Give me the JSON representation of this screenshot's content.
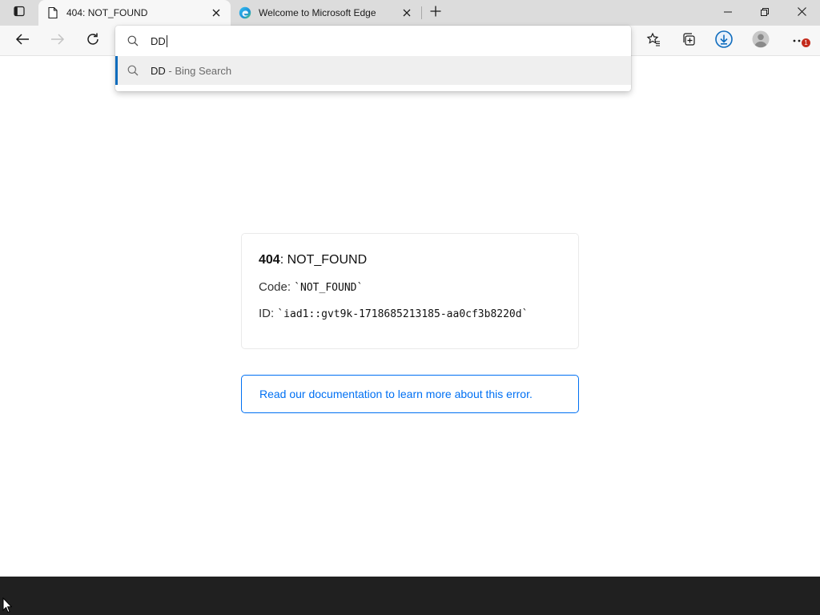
{
  "browser": {
    "tabs": [
      {
        "title": "404: NOT_FOUND",
        "icon": "page-icon",
        "active": true
      },
      {
        "title": "Welcome to Microsoft Edge",
        "icon": "edge-logo-icon",
        "active": false
      }
    ],
    "window_controls": [
      "minimize-icon",
      "restore-icon",
      "close-icon"
    ]
  },
  "omnibox": {
    "value": "DD",
    "suggestions": [
      {
        "text": "DD",
        "separator": " - ",
        "source": "Bing Search",
        "icon": "search-icon"
      }
    ]
  },
  "toolbar_icons": [
    "back-icon",
    "forward-icon",
    "refresh-icon",
    "favorites-icon",
    "collections-icon",
    "downloads-icon",
    "profile-avatar-icon",
    "more-icon"
  ],
  "notification_badge": "1",
  "error": {
    "code_number": "404",
    "code_text": ": NOT_FOUND",
    "code_label": "Code: ",
    "code_value": "`NOT_FOUND`",
    "id_label": "ID: ",
    "id_value": "`iad1::gvt9k-1718685213185-aa0cf3b8220d`",
    "doc_link": "Read our documentation to learn more about this error."
  },
  "colors": {
    "accent": "#0f6cbd",
    "link": "#0070f3",
    "badge": "#c42b1c",
    "taskbar": "#202020"
  }
}
